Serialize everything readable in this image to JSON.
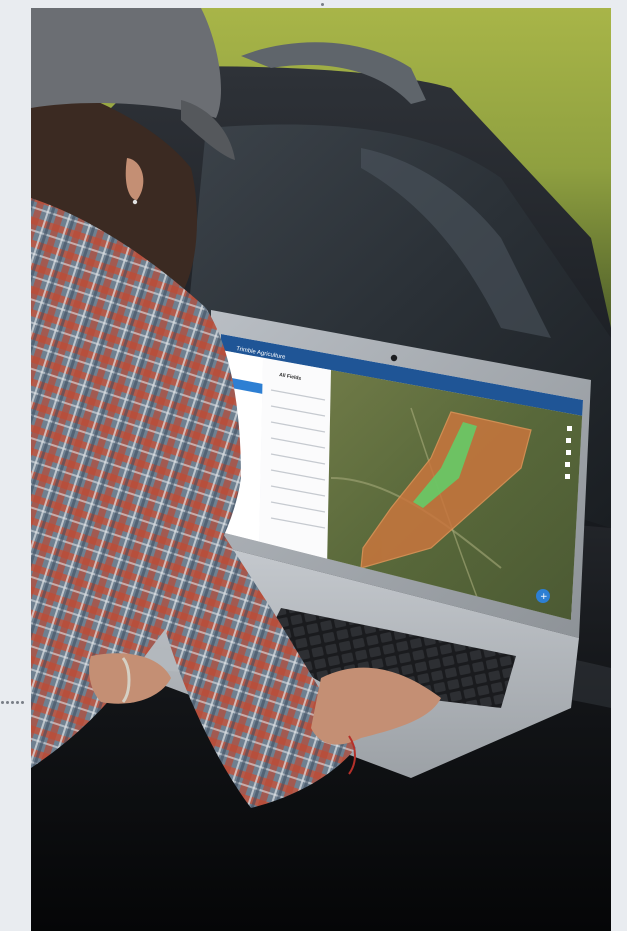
{
  "scene": {
    "type": "photo",
    "subject": "person at laptop on car hood"
  },
  "app": {
    "logo_text": "Trimble Agriculture",
    "fields_title": "All Fields",
    "colors": {
      "header_bg": "#1f5596",
      "accent_blue": "#2d7fd3",
      "field_orange": "#c9763e",
      "zone_green": "#5fd06a",
      "map_green": "#5d6c3a"
    }
  },
  "guides": {
    "colors": {
      "dot": "#7a7f87"
    }
  }
}
